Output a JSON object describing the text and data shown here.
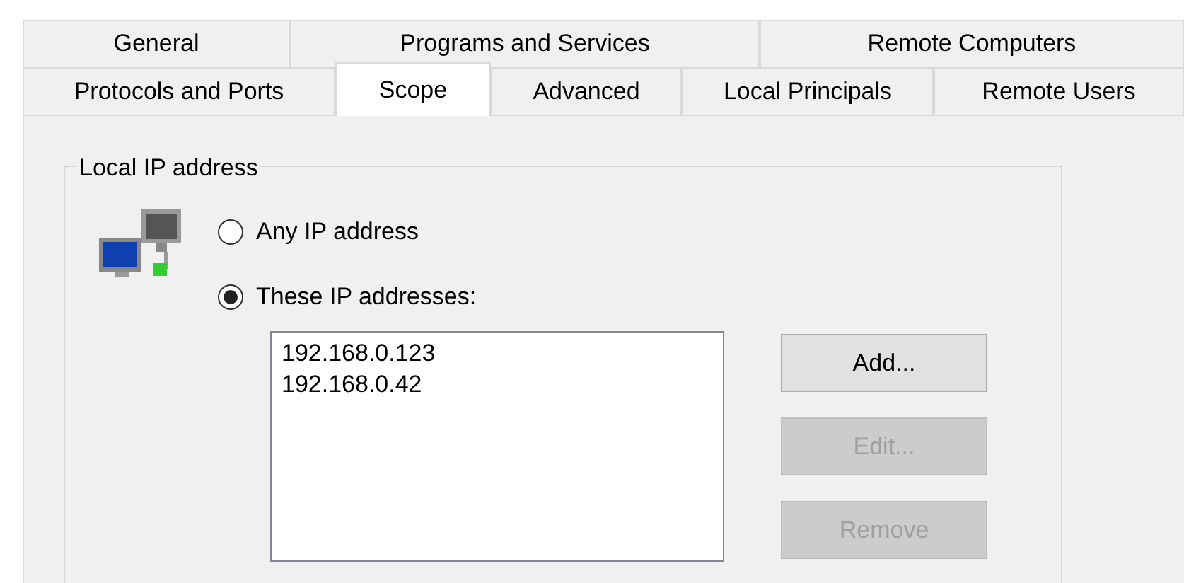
{
  "tabs": [
    [
      {
        "label": "General",
        "selected": false
      },
      {
        "label": "Programs and Services",
        "selected": false
      },
      {
        "label": "Remote Computers",
        "selected": false
      }
    ],
    [
      {
        "label": "Protocols and Ports",
        "selected": false
      },
      {
        "label": "Scope",
        "selected": true
      },
      {
        "label": "Advanced",
        "selected": false
      },
      {
        "label": "Local Principals",
        "selected": false
      },
      {
        "label": "Remote Users",
        "selected": false
      }
    ]
  ],
  "group": {
    "title": "Local IP address",
    "options": [
      {
        "label": "Any IP address",
        "selected": false
      },
      {
        "label": "These IP addresses:",
        "selected": true
      }
    ],
    "addresses": [
      "192.168.0.123",
      "192.168.0.42"
    ],
    "buttons": [
      {
        "label": "Add...",
        "disabled": false
      },
      {
        "label": "Edit...",
        "disabled": true
      },
      {
        "label": "Remove",
        "disabled": true
      }
    ]
  }
}
